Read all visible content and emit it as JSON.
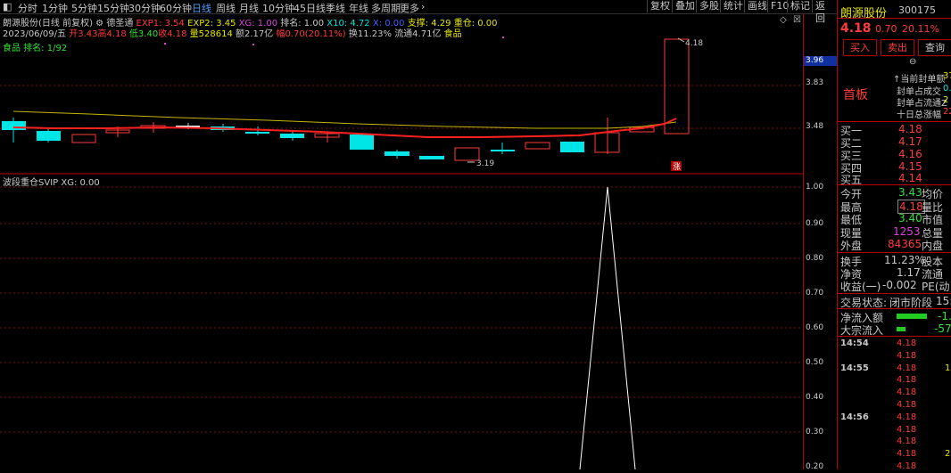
{
  "toolbar": {
    "tabs": [
      "分时",
      "1分钟",
      "5分钟",
      "15分钟",
      "30分钟",
      "60分钟",
      "日线",
      "周线",
      "月线",
      "10分钟",
      "45日线",
      "季线",
      "年线",
      "多周期",
      "更多"
    ],
    "active": "日线",
    "right_buttons": [
      "复权",
      "叠加",
      "多股",
      "统计",
      "画线",
      "F10",
      "标记",
      "返回"
    ]
  },
  "info": {
    "line1_name": "朗源股份(日线 前复权)",
    "indicator": "德圣通",
    "exp1": "EXP1: 3.54",
    "exp2": "EXP2: 3.45",
    "xg": "XG: 1.00",
    "rank": "排名: 1.00",
    "x10": "X10: 4.72",
    "x_hidden": "X: 0.00",
    "support": "支撑: 4.29",
    "heavy": "重仓: 0.00",
    "date": "2023/06/09/五",
    "open": "开3.43",
    "high": "高4.18",
    "low": "低3.40",
    "close": "收4.18",
    "vol": "量528614",
    "amount": "额2.17亿",
    "amp": "幅0.70(20.11%)",
    "turnover": "换11.23%",
    "float_cap": "流通4.71亿",
    "sector": "食品",
    "rank_line": "食品 排名: 1/92"
  },
  "price_axis": [
    "3.96",
    "3.83",
    "3.48"
  ],
  "price_labels": {
    "high": "4.18",
    "low": "3.19",
    "zhang": "涨"
  },
  "lower": {
    "title": "波段重仓SVIP",
    "xg": "XG: 0.00",
    "axis": [
      "1.00",
      "0.90",
      "0.80",
      "0.70",
      "0.60",
      "0.50",
      "0.40",
      "0.30",
      "0.20"
    ]
  },
  "quote": {
    "name": "朗源股份",
    "code": "300175",
    "price": "4.18",
    "change": "0.70",
    "pct": "20.11%",
    "buy": "买入",
    "sell": "卖出",
    "query": "查询",
    "board": "首板",
    "seal_rows": [
      {
        "label": "↑当前封单额",
        "value": "37"
      },
      {
        "label": "封单占成交",
        "value": "0."
      },
      {
        "label": "封单占流通Z",
        "value": "2"
      },
      {
        "label": "十日总涨幅",
        "value": "22"
      }
    ],
    "bids": [
      {
        "label": "买一",
        "price": "4.18"
      },
      {
        "label": "买二",
        "price": "4.17"
      },
      {
        "label": "买三",
        "price": "4.16"
      },
      {
        "label": "买四",
        "price": "4.15"
      },
      {
        "label": "买五",
        "price": "4.14"
      }
    ],
    "stats": [
      {
        "l1": "今开",
        "v1": "3.43",
        "l2": "均价",
        "c": "green"
      },
      {
        "l1": "最高",
        "v1": "4.18",
        "l2": "量比",
        "c": "red"
      },
      {
        "l1": "最低",
        "v1": "3.40",
        "l2": "市值",
        "c": "green"
      },
      {
        "l1": "现量",
        "v1": "1253",
        "l2": "总量",
        "c": "magenta"
      },
      {
        "l1": "外盘",
        "v1": "84365",
        "l2": "内盘",
        "c": "red"
      }
    ],
    "fin": [
      {
        "l1": "换手",
        "v1": "11.23%",
        "l2": "股本"
      },
      {
        "l1": "净资",
        "v1": "1.17",
        "l2": "流通"
      },
      {
        "l1": "收益(一)",
        "v1": "-0.002",
        "l2": "PE(动)"
      }
    ],
    "status_label": "交易状态:",
    "status_value": "闭市阶段",
    "status_time": "15:",
    "flow": [
      {
        "label": "净流入额",
        "value": "-1."
      },
      {
        "label": "大宗流入",
        "value": "-57"
      }
    ],
    "ticks": [
      {
        "time": "14:54",
        "price": "4.18",
        "vol": ""
      },
      {
        "time": "",
        "price": "4.18",
        "vol": ""
      },
      {
        "time": "14:55",
        "price": "4.18",
        "vol": "1"
      },
      {
        "time": "",
        "price": "4.18",
        "vol": ""
      },
      {
        "time": "",
        "price": "4.18",
        "vol": ""
      },
      {
        "time": "",
        "price": "4.18",
        "vol": ""
      },
      {
        "time": "14:56",
        "price": "4.18",
        "vol": ""
      },
      {
        "time": "",
        "price": "4.18",
        "vol": ""
      },
      {
        "time": "",
        "price": "4.18",
        "vol": ""
      },
      {
        "time": "",
        "price": "4.18",
        "vol": "2"
      },
      {
        "time": "",
        "price": "4.18",
        "vol": ""
      }
    ]
  }
}
